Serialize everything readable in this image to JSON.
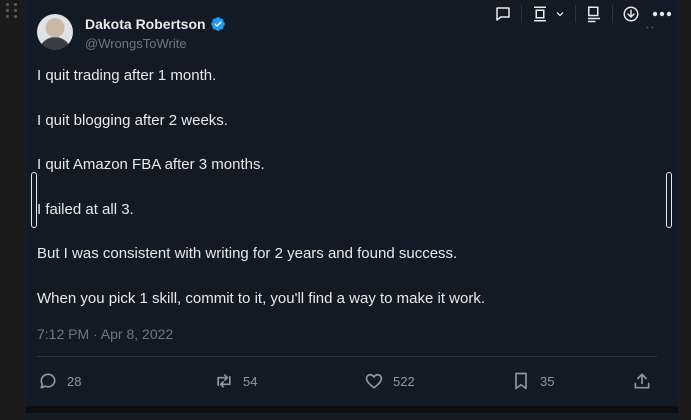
{
  "author": {
    "name": "Dakota Robertson",
    "handle": "@WrongsToWrite",
    "verified": true,
    "verified_color": "#1d9bf0"
  },
  "toolbar": {
    "icons": [
      "comment-icon",
      "frame-icon",
      "chevron-down-icon",
      "layout-icon",
      "download-icon",
      "more-icon"
    ]
  },
  "tweet": {
    "lines": [
      "I quit trading after 1 month.",
      "I quit blogging after 2 weeks.",
      "I quit Amazon FBA after 3 months.",
      "I failed at all 3.",
      "But I was consistent with writing for 2 years and found success.",
      "When you pick 1 skill, commit to it, you'll find a way to make it work."
    ],
    "timestamp": "7:12 PM · Apr 8, 2022"
  },
  "metrics": {
    "replies": "28",
    "retweets": "54",
    "likes": "522",
    "bookmarks": "35"
  },
  "colors": {
    "card_bg": "#121a25",
    "text": "#e7e9ea",
    "muted": "#71767b",
    "accent": "#1d9bf0"
  }
}
